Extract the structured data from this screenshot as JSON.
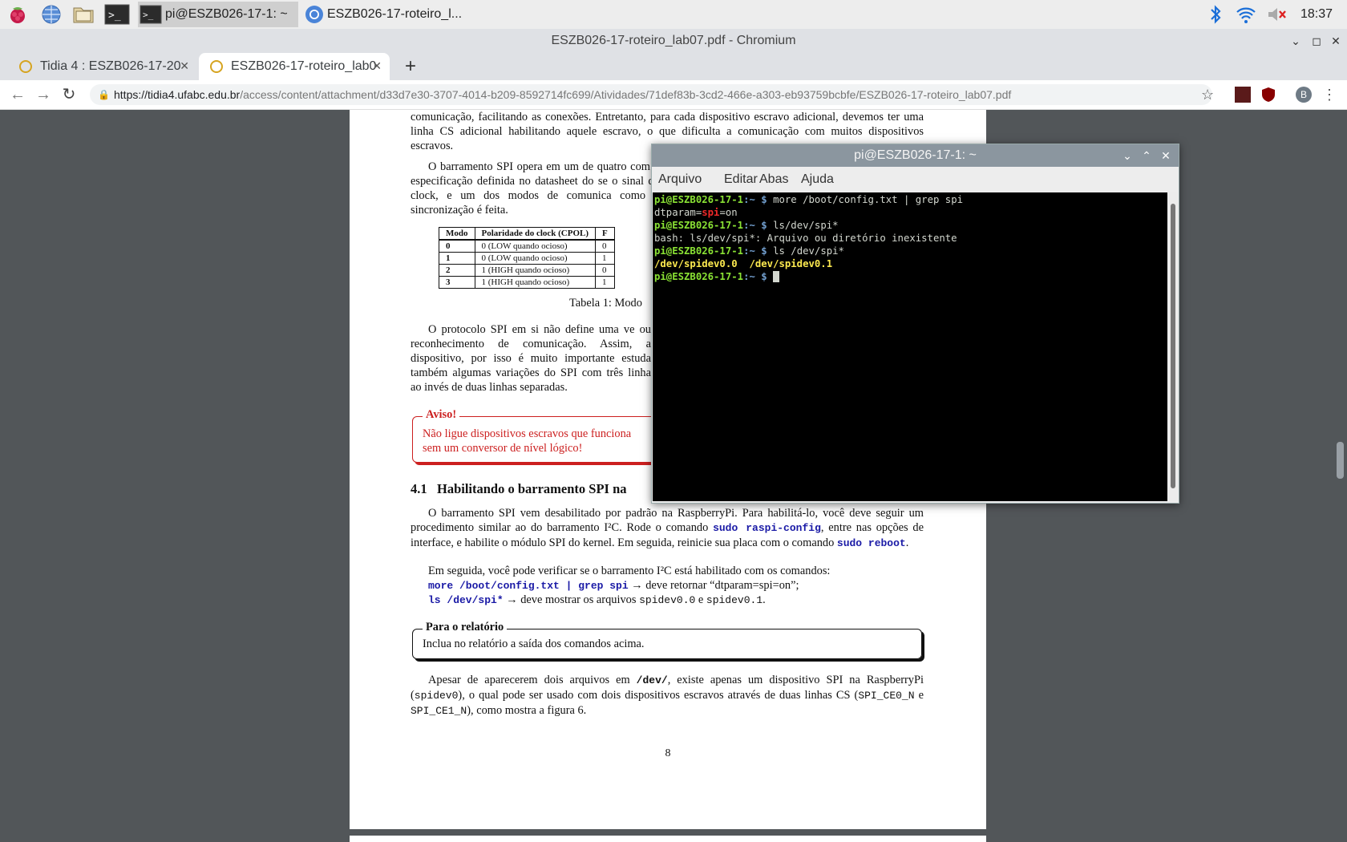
{
  "taskbar": {
    "tasks": [
      {
        "label": "pi@ESZB026-17-1: ~",
        "icon": "terminal-icon"
      },
      {
        "label": "ESZB026-17-roteiro_l...",
        "icon": "chromium-icon"
      }
    ],
    "clock": "18:37"
  },
  "browser": {
    "window_title": "ESZB026-17-roteiro_lab07.pdf - Chromium",
    "tabs": [
      {
        "title": "Tidia 4 : ESZB026-17-20",
        "active": false
      },
      {
        "title": "ESZB026-17-roteiro_lab0",
        "active": true
      }
    ],
    "url_host": "https://tidia4.ufabc.edu.br",
    "url_path": "/access/content/attachment/d33d7e30-3707-4014-b209-8592714fc699/Atividades/71def83b-3cd2-466e-a303-eb93759bcbfe/ESZB026-17-roteiro_lab07.pdf",
    "profile_initial": "B"
  },
  "pdf": {
    "para1": "comunicação, facilitando as conexões. Entretanto, para cada dispositivo escravo adicional, devemos ter uma linha CS adicional habilitando aquele escravo, o que dificulta a comunicação com muitos dispositivos escravos.",
    "para2": "O barramento SPI opera em um de quatro com a especificação definida no datasheet do se o sinal de clock, e um dos modos de comunica como a sincronização é feita.",
    "table": {
      "headers": [
        "Modo",
        "Polaridade do clock (CPOL)",
        "F"
      ],
      "rows": [
        [
          "0",
          "0 (LOW quando ocioso)",
          "0"
        ],
        [
          "1",
          "0 (LOW quando ocioso)",
          "1"
        ],
        [
          "2",
          "1 (HIGH quando ocioso)",
          "0"
        ],
        [
          "3",
          "1 (HIGH quando ocioso)",
          "1"
        ]
      ],
      "caption": "Tabela 1: Modo"
    },
    "para3": "O protocolo SPI em si não define uma ve ou reconhecimento de comunicação. Assim, a dispositivo, por isso é muito importante estuda também algumas variações do SPI com três linha ao invés de duas linhas separadas.",
    "warning_title": "Aviso!",
    "warning_line1": "Não ligue dispositivos escravos que funciona",
    "warning_line2": "sem um conversor de nível lógico!",
    "section_number": "4.1",
    "section_title": "Habilitando o barramento SPI na",
    "para4_a": "O barramento SPI vem desabilitado por padrão na RaspberryPi. Para habilitá-lo, você deve seguir um procedimento similar ao do barramento I²C. Rode o comando ",
    "para4_cmd1": "sudo raspi-config",
    "para4_b": ", entre nas opções de interface, e habilite o módulo SPI do kernel. Em seguida, reinicie sua placa com o comando ",
    "para4_cmd2": "sudo reboot",
    "para4_c": ".",
    "para5": "Em seguida, você pode verificar se o barramento I²C está habilitado com os comandos:",
    "cmd1": "more /boot/config.txt | grep spi",
    "cmd1_desc": " → deve retornar “dtparam=spi=on”;",
    "cmd2": "ls /dev/spi*",
    "cmd2_desc_a": " → deve mostrar os arquivos ",
    "cmd2_file1": "spidev0.0",
    "cmd2_and": " e ",
    "cmd2_file2": "spidev0.1",
    "cmd2_end": ".",
    "report_title": "Para o relatório",
    "report_body": "Inclua no relatório a saída dos comandos acima.",
    "para6_a": "Apesar de aparecerem dois arquivos em ",
    "para6_dev": "/dev/",
    "para6_b": ", existe apenas um dispositivo SPI na RaspberryPi (",
    "para6_spidev": "spidev0",
    "para6_c": "), o qual pode ser usado com dois dispositivos escravos através de duas linhas CS (",
    "para6_ce0": "SPI_CE0_N",
    "para6_d": " e ",
    "para6_ce1": "SPI_CE1_N",
    "para6_e": "), como mostra a figura 6.",
    "page_number": "8"
  },
  "terminal": {
    "title": "pi@ESZB026-17-1: ~",
    "menu": [
      "Arquivo",
      "Editar",
      "Abas",
      "Ajuda"
    ],
    "prompt_user": "pi@ESZB026-17-1",
    "prompt_path": ":~ $",
    "cmd1": " more /boot/config.txt | grep spi",
    "out1_a": "dtparam=",
    "out1_b": "spi",
    "out1_c": "=on",
    "cmd2": " ls/dev/spi*",
    "out2": "bash: ls/dev/spi*: Arquivo ou diretório inexistente",
    "cmd3": " ls /dev/spi*",
    "out3": "/dev/spidev0.0  /dev/spidev0.1"
  }
}
